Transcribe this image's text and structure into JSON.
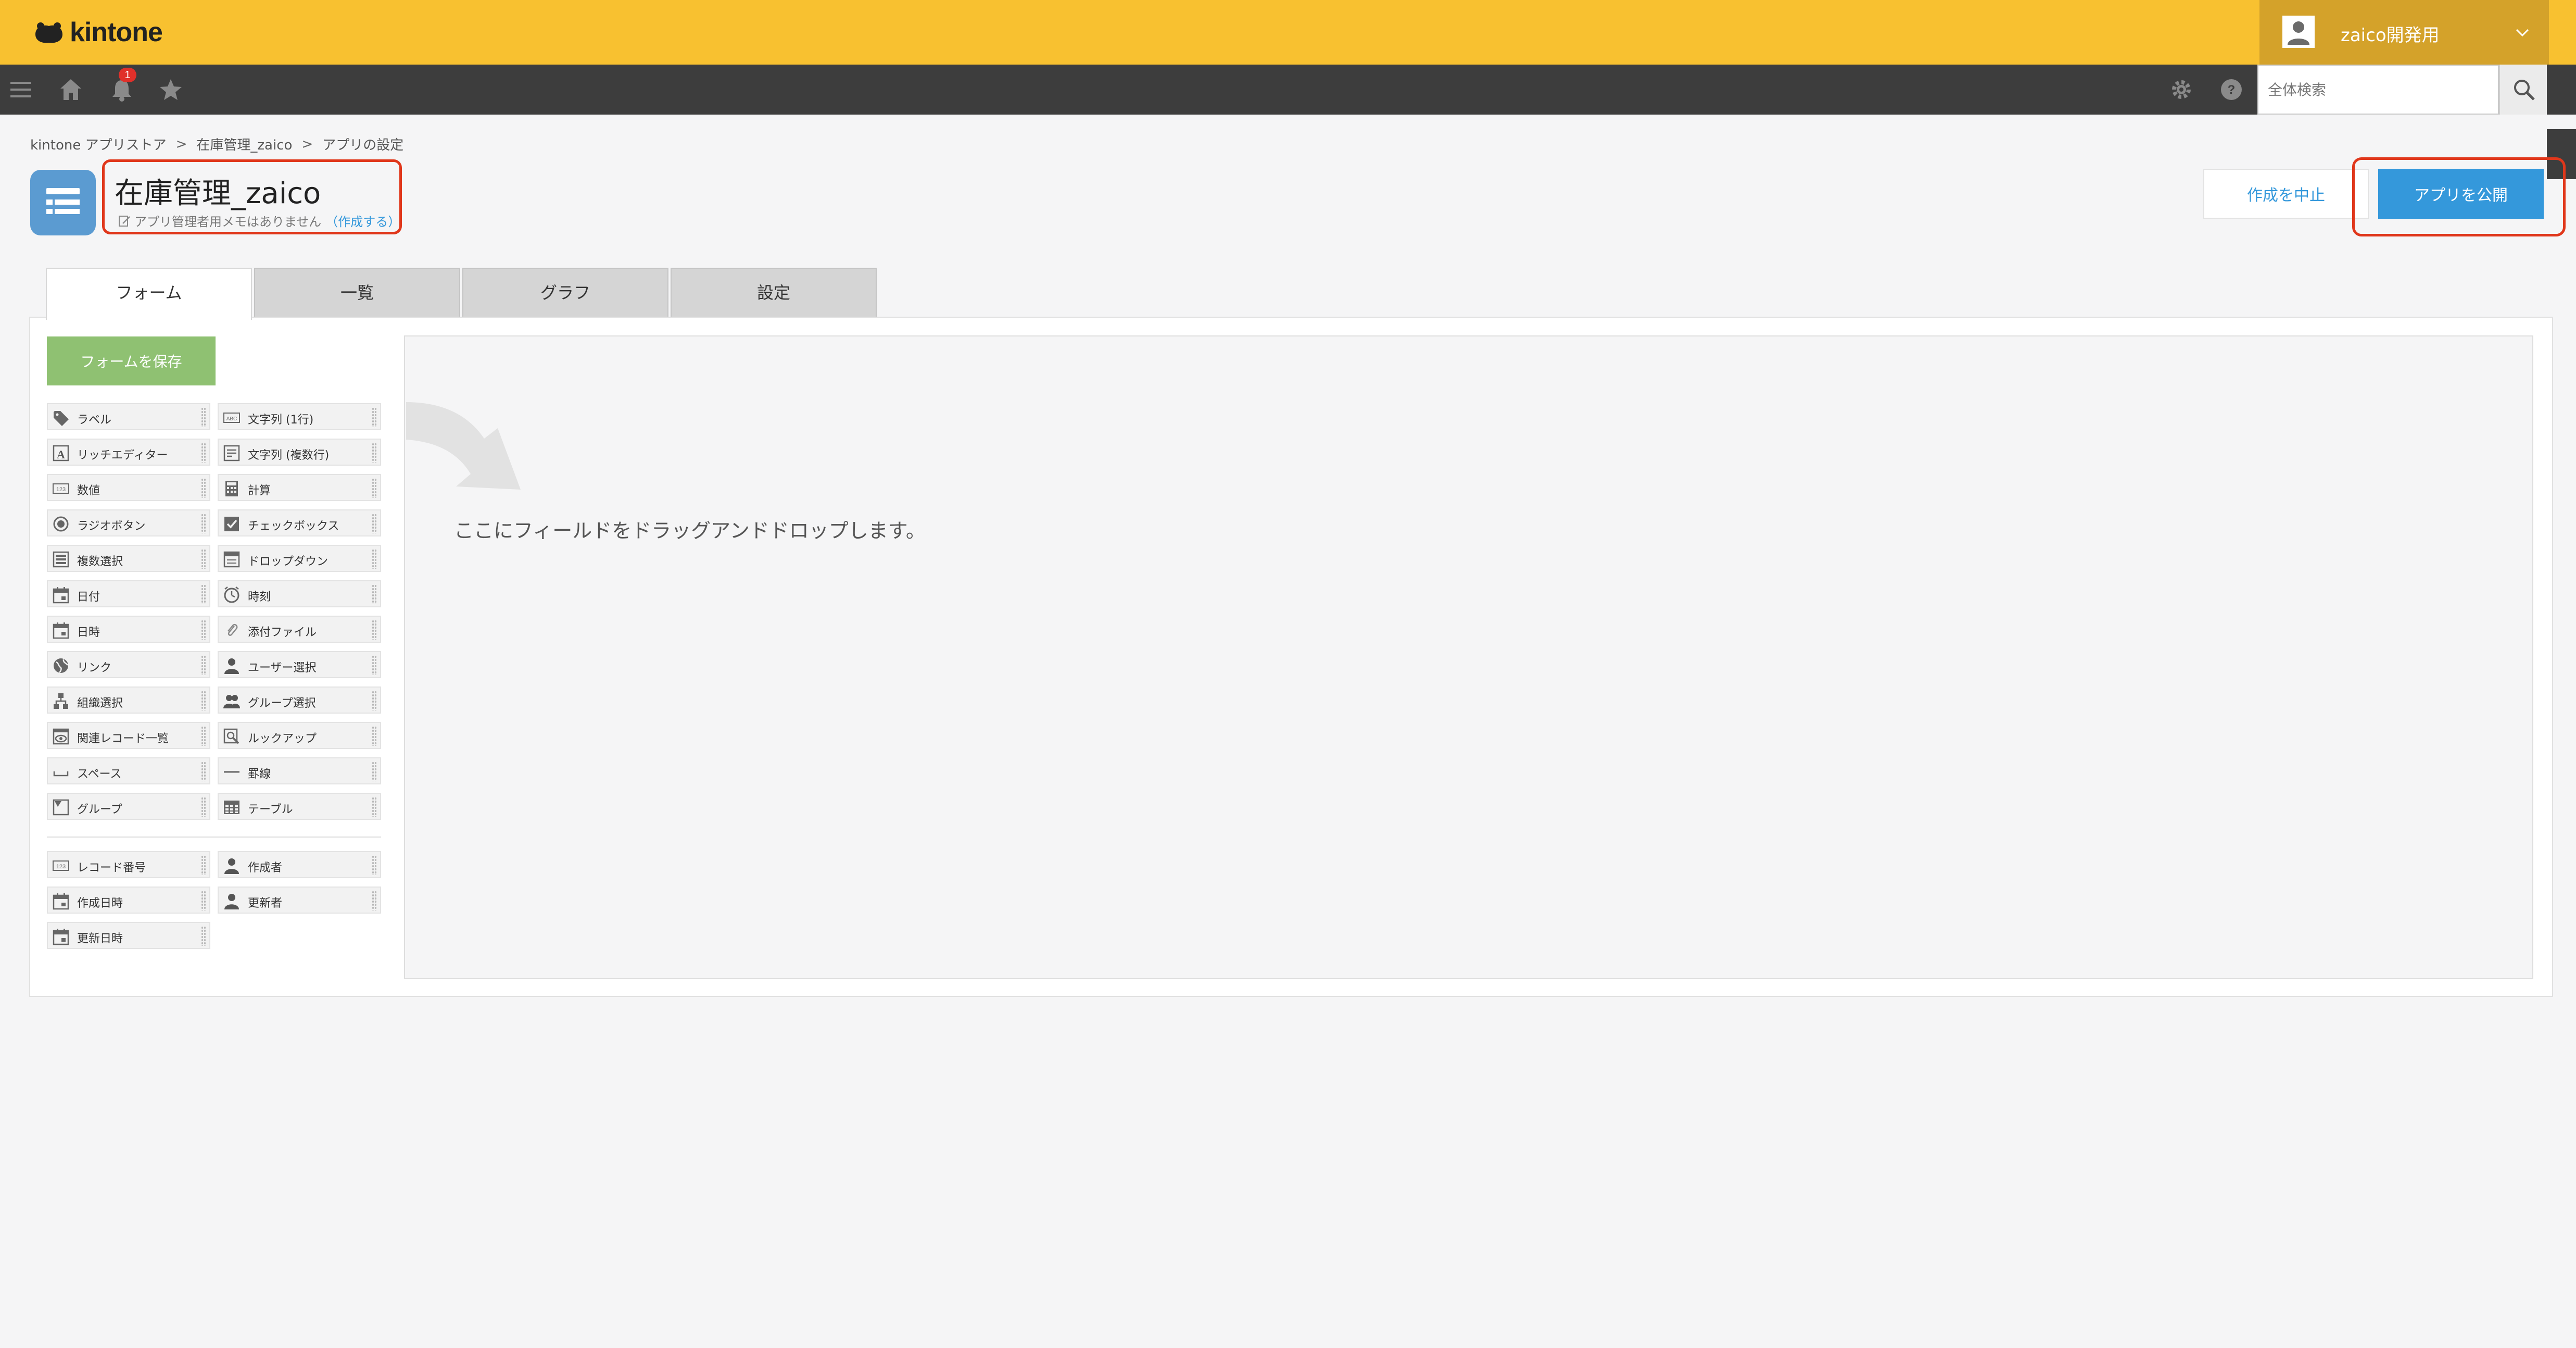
{
  "header": {
    "logo_text": "kintone",
    "user_name": "zaico開発用",
    "notification_count": "1",
    "search_placeholder": "全体検索"
  },
  "breadcrumb": [
    "kintone アプリストア",
    "在庫管理_zaico",
    "アプリの設定"
  ],
  "breadcrumb_separator": ">",
  "app": {
    "title": "在庫管理_zaico",
    "memo_text": "アプリ管理者用メモはありません",
    "memo_link": "（作成する）"
  },
  "actions": {
    "cancel_label": "作成を中止",
    "publish_label": "アプリを公開"
  },
  "tabs": [
    "フォーム",
    "一覧",
    "グラフ",
    "設定"
  ],
  "active_tab": "フォーム",
  "form": {
    "save_label": "フォームを保存",
    "drop_hint": "ここにフィールドをドラッグアンドドロップします。"
  },
  "palette": [
    {
      "label": "ラベル",
      "icon": "tag-icon"
    },
    {
      "label": "文字列 (1行)",
      "icon": "abc-text-icon"
    },
    {
      "label": "リッチエディター",
      "icon": "rich-editor-icon"
    },
    {
      "label": "文字列 (複数行)",
      "icon": "multiline-text-icon"
    },
    {
      "label": "数値",
      "icon": "number-icon"
    },
    {
      "label": "計算",
      "icon": "calculator-icon"
    },
    {
      "label": "ラジオボタン",
      "icon": "radio-icon"
    },
    {
      "label": "チェックボックス",
      "icon": "checkbox-icon"
    },
    {
      "label": "複数選択",
      "icon": "multi-select-icon"
    },
    {
      "label": "ドロップダウン",
      "icon": "dropdown-icon"
    },
    {
      "label": "日付",
      "icon": "calendar-icon"
    },
    {
      "label": "時刻",
      "icon": "clock-icon"
    },
    {
      "label": "日時",
      "icon": "calendar-icon"
    },
    {
      "label": "添付ファイル",
      "icon": "paperclip-icon"
    },
    {
      "label": "リンク",
      "icon": "globe-icon"
    },
    {
      "label": "ユーザー選択",
      "icon": "user-icon"
    },
    {
      "label": "組織選択",
      "icon": "org-tree-icon"
    },
    {
      "label": "グループ選択",
      "icon": "group-icon"
    },
    {
      "label": "関連レコード一覧",
      "icon": "related-records-icon"
    },
    {
      "label": "ルックアップ",
      "icon": "lookup-icon"
    },
    {
      "label": "スペース",
      "icon": "space-icon"
    },
    {
      "label": "罫線",
      "icon": "line-icon"
    },
    {
      "label": "グループ",
      "icon": "group-folder-icon"
    },
    {
      "label": "テーブル",
      "icon": "table-icon"
    }
  ],
  "system_fields": [
    {
      "label": "レコード番号",
      "icon": "number-icon"
    },
    {
      "label": "作成者",
      "icon": "user-icon"
    },
    {
      "label": "作成日時",
      "icon": "calendar-icon"
    },
    {
      "label": "更新者",
      "icon": "user-icon"
    },
    {
      "label": "更新日時",
      "icon": "calendar-icon"
    }
  ],
  "colors": {
    "header_bg": "#f8c130",
    "navbar_bg": "#3d3d3d",
    "primary": "#3498db",
    "save_green": "#8fc172",
    "highlight_red": "#e0371b"
  }
}
